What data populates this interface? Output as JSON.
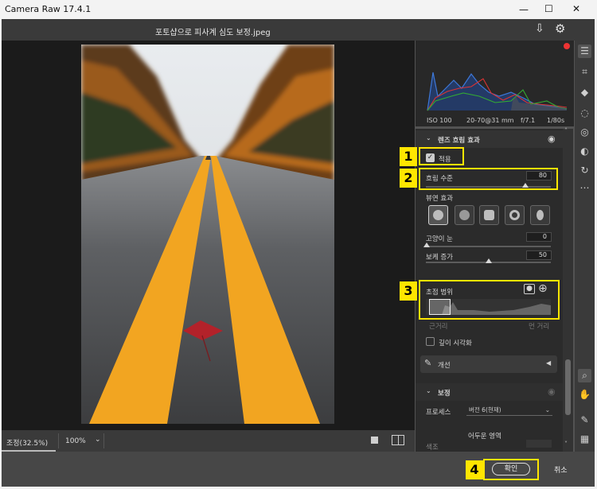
{
  "app": {
    "title": "Camera Raw 17.4.1"
  },
  "window": {
    "minimize": "—",
    "maximize": "☐",
    "close": "✕"
  },
  "header": {
    "filename": "포토샵으로 피사계 심도 보정.jpeg"
  },
  "exif": {
    "iso": "ISO 100",
    "lens": "20-70@31 mm",
    "aperture": "f/7.1",
    "shutter": "1/80s"
  },
  "lens_blur": {
    "section_title": "렌즈 흐림 효과",
    "apply_label": "적용",
    "blur_amount_label": "흐림 수준",
    "blur_amount_value": "80",
    "blur_amount": 80,
    "bokeh_label": "뷰연 효과",
    "cats_eye_label": "고양이 눈",
    "cats_eye_value": "0",
    "cats_eye": 0,
    "boost_label": "보케 증가",
    "boost_value": "50",
    "boost": 50,
    "focal_label": "초점 범위",
    "near_label": "근거리",
    "far_label": "먼 거리",
    "visualize_label": "깊이 시각화",
    "refine_label": "개선"
  },
  "correction": {
    "section_title": "보정",
    "process_label": "프로세스",
    "process_value": "버전 6(현재)",
    "dark_area_label": "어두운 영역",
    "color_label": "색조"
  },
  "bottombar": {
    "zoom_label": "조정(32.5%)",
    "zoom_value": "100%"
  },
  "footer": {
    "ok": "확인",
    "cancel": "취소"
  },
  "annotations": {
    "n1": "1",
    "n2": "2",
    "n3": "3",
    "n4": "4"
  },
  "colors": {
    "highlight": "#ffe600",
    "panel": "#2b2b2b",
    "road": "#f2a521"
  }
}
